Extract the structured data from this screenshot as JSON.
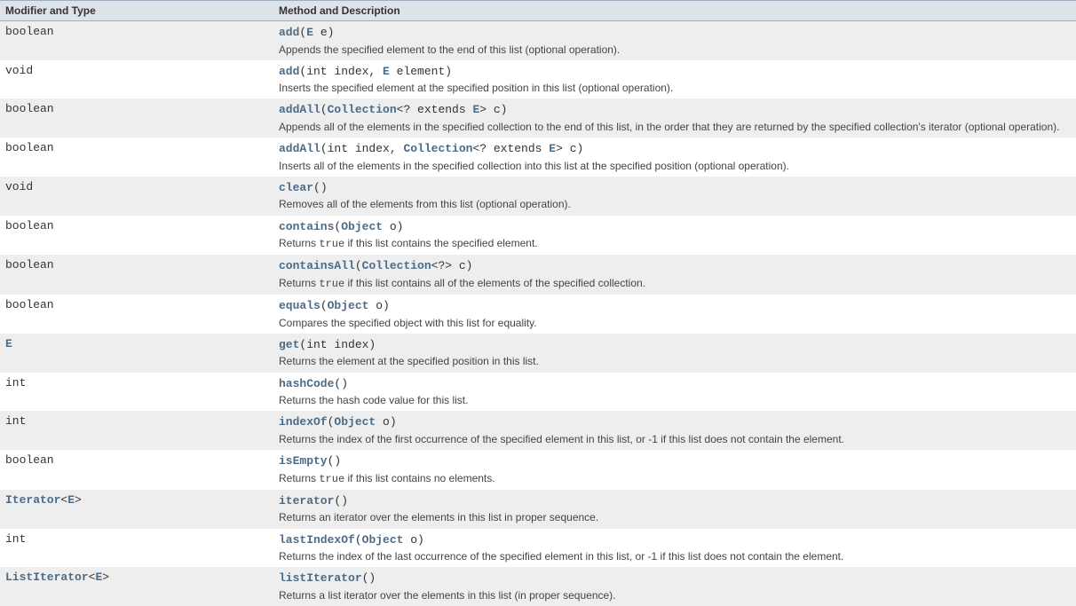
{
  "headers": {
    "modifier": "Modifier and Type",
    "method": "Method and Description"
  },
  "rows": [
    {
      "modifier": [
        {
          "t": "boolean"
        }
      ],
      "sig": [
        {
          "t": "add",
          "k": "m"
        },
        {
          "t": "("
        },
        {
          "t": "E",
          "k": "a"
        },
        {
          "t": " e)"
        }
      ],
      "desc": [
        {
          "t": "Appends the specified element to the end of this list (optional operation)."
        }
      ]
    },
    {
      "modifier": [
        {
          "t": "void"
        }
      ],
      "sig": [
        {
          "t": "add",
          "k": "m"
        },
        {
          "t": "(int index, "
        },
        {
          "t": "E",
          "k": "a"
        },
        {
          "t": " element)"
        }
      ],
      "desc": [
        {
          "t": "Inserts the specified element at the specified position in this list (optional operation)."
        }
      ]
    },
    {
      "modifier": [
        {
          "t": "boolean"
        }
      ],
      "sig": [
        {
          "t": "addAll",
          "k": "m"
        },
        {
          "t": "("
        },
        {
          "t": "Collection",
          "k": "a"
        },
        {
          "t": "<? extends "
        },
        {
          "t": "E",
          "k": "a"
        },
        {
          "t": "> c)"
        }
      ],
      "desc": [
        {
          "t": "Appends all of the elements in the specified collection to the end of this list, in the order that they are returned by the specified collection's iterator (optional operation)."
        }
      ]
    },
    {
      "modifier": [
        {
          "t": "boolean"
        }
      ],
      "sig": [
        {
          "t": "addAll",
          "k": "m"
        },
        {
          "t": "(int index, "
        },
        {
          "t": "Collection",
          "k": "a"
        },
        {
          "t": "<? extends "
        },
        {
          "t": "E",
          "k": "a"
        },
        {
          "t": "> c)"
        }
      ],
      "desc": [
        {
          "t": "Inserts all of the elements in the specified collection into this list at the specified position (optional operation)."
        }
      ]
    },
    {
      "modifier": [
        {
          "t": "void"
        }
      ],
      "sig": [
        {
          "t": "clear",
          "k": "m"
        },
        {
          "t": "()"
        }
      ],
      "desc": [
        {
          "t": "Removes all of the elements from this list (optional operation)."
        }
      ]
    },
    {
      "modifier": [
        {
          "t": "boolean"
        }
      ],
      "sig": [
        {
          "t": "contains",
          "k": "m"
        },
        {
          "t": "("
        },
        {
          "t": "Object",
          "k": "a"
        },
        {
          "t": " o)"
        }
      ],
      "desc": [
        {
          "t": "Returns "
        },
        {
          "t": "true",
          "k": "c"
        },
        {
          "t": " if this list contains the specified element."
        }
      ]
    },
    {
      "modifier": [
        {
          "t": "boolean"
        }
      ],
      "sig": [
        {
          "t": "containsAll",
          "k": "m"
        },
        {
          "t": "("
        },
        {
          "t": "Collection",
          "k": "a"
        },
        {
          "t": "<?> c)"
        }
      ],
      "desc": [
        {
          "t": "Returns "
        },
        {
          "t": "true",
          "k": "c"
        },
        {
          "t": " if this list contains all of the elements of the specified collection."
        }
      ]
    },
    {
      "modifier": [
        {
          "t": "boolean"
        }
      ],
      "sig": [
        {
          "t": "equals",
          "k": "m"
        },
        {
          "t": "("
        },
        {
          "t": "Object",
          "k": "a"
        },
        {
          "t": " o)"
        }
      ],
      "desc": [
        {
          "t": "Compares the specified object with this list for equality."
        }
      ]
    },
    {
      "modifier": [
        {
          "t": "E",
          "k": "a"
        }
      ],
      "sig": [
        {
          "t": "get",
          "k": "m"
        },
        {
          "t": "(int index)"
        }
      ],
      "desc": [
        {
          "t": "Returns the element at the specified position in this list."
        }
      ]
    },
    {
      "modifier": [
        {
          "t": "int"
        }
      ],
      "sig": [
        {
          "t": "hashCode",
          "k": "m"
        },
        {
          "t": "()"
        }
      ],
      "desc": [
        {
          "t": "Returns the hash code value for this list."
        }
      ]
    },
    {
      "modifier": [
        {
          "t": "int"
        }
      ],
      "sig": [
        {
          "t": "indexOf",
          "k": "m"
        },
        {
          "t": "("
        },
        {
          "t": "Object",
          "k": "a"
        },
        {
          "t": " o)"
        }
      ],
      "desc": [
        {
          "t": "Returns the index of the first occurrence of the specified element in this list, or -1 if this list does not contain the element."
        }
      ]
    },
    {
      "modifier": [
        {
          "t": "boolean"
        }
      ],
      "sig": [
        {
          "t": "isEmpty",
          "k": "m"
        },
        {
          "t": "()"
        }
      ],
      "desc": [
        {
          "t": "Returns "
        },
        {
          "t": "true",
          "k": "c"
        },
        {
          "t": " if this list contains no elements."
        }
      ]
    },
    {
      "modifier": [
        {
          "t": "Iterator",
          "k": "a"
        },
        {
          "t": "<"
        },
        {
          "t": "E",
          "k": "a"
        },
        {
          "t": ">"
        }
      ],
      "sig": [
        {
          "t": "iterator",
          "k": "m"
        },
        {
          "t": "()"
        }
      ],
      "desc": [
        {
          "t": "Returns an iterator over the elements in this list in proper sequence."
        }
      ]
    },
    {
      "modifier": [
        {
          "t": "int"
        }
      ],
      "sig": [
        {
          "t": "lastIndexOf",
          "k": "m"
        },
        {
          "t": "("
        },
        {
          "t": "Object",
          "k": "a"
        },
        {
          "t": " o)"
        }
      ],
      "desc": [
        {
          "t": "Returns the index of the last occurrence of the specified element in this list, or -1 if this list does not contain the element."
        }
      ]
    },
    {
      "modifier": [
        {
          "t": "ListIterator",
          "k": "a"
        },
        {
          "t": "<"
        },
        {
          "t": "E",
          "k": "a"
        },
        {
          "t": ">"
        }
      ],
      "sig": [
        {
          "t": "listIterator",
          "k": "m"
        },
        {
          "t": "()"
        }
      ],
      "desc": [
        {
          "t": "Returns a list iterator over the elements in this list (in proper sequence)."
        }
      ]
    }
  ]
}
